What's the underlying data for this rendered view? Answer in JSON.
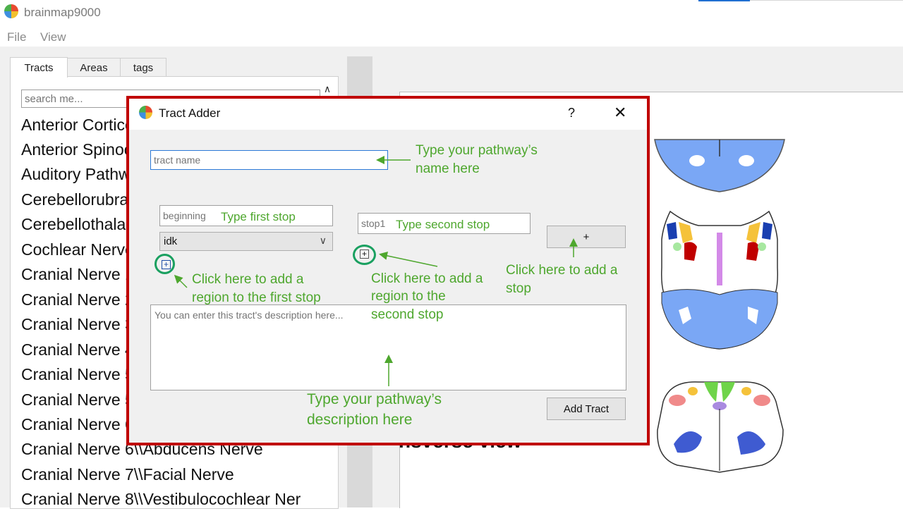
{
  "app": {
    "title": "brainmap9000"
  },
  "menu": [
    "File",
    "View"
  ],
  "tabs": [
    "Tracts",
    "Areas",
    "tags"
  ],
  "search": {
    "placeholder": "search me..."
  },
  "tracts": [
    "Anterior Corticospinal",
    "Anterior Spinocerebellar",
    "Auditory Pathway",
    "Cerebellorubral",
    "Cerebellothalamic",
    "Cochlear Nerve",
    "Cranial Nerve 1",
    "Cranial Nerve 2",
    "Cranial Nerve 3",
    "Cranial Nerve 4",
    "Cranial Nerve 5",
    "Cranial Nerve 5",
    "Cranial Nerve 6",
    "Cranial Nerve 6\\\\Abducens Nerve",
    "Cranial Nerve 7\\\\Facial Nerve",
    "Cranial Nerve 8\\\\Vestibulocochlear Ner"
  ],
  "view_label": "nsverse view",
  "dialog": {
    "title": "Tract Adder",
    "help": "?",
    "close": "✕",
    "tract_name_placeholder": "tract name",
    "first_stop_placeholder": "beginning",
    "region_select": "idk",
    "second_stop_placeholder": "stop1",
    "add_stop_label": "+",
    "description_placeholder": "You can enter this tract's description here...",
    "add_tract_label": "Add Tract"
  },
  "annotations": {
    "name_hint": [
      "Type your pathway’s",
      "name here"
    ],
    "first_stop_hint": "Type first stop",
    "second_stop_hint": "Type second stop",
    "first_region_hint": [
      "Click here to add a",
      "region to the first stop"
    ],
    "second_region_hint": [
      "Click here to add a",
      "region to the",
      "second stop"
    ],
    "add_stop_hint": [
      "Click here to add a",
      "stop"
    ],
    "description_hint": [
      "Type your pathway’s",
      "description here"
    ]
  },
  "colors": {
    "highlight_frame": "#c00000",
    "annotation": "#4ea72e",
    "brain_blue": "#7aa7f5"
  }
}
